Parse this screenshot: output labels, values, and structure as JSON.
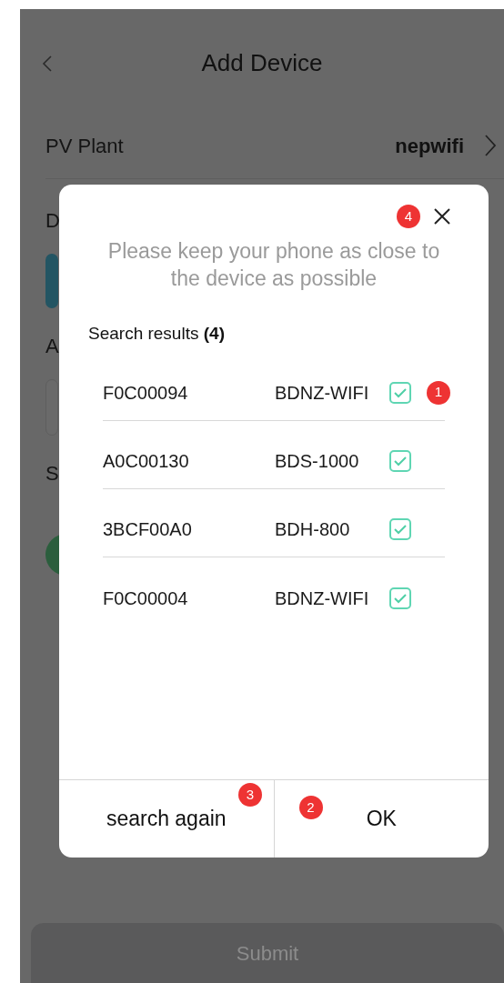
{
  "header": {
    "title": "Add Device"
  },
  "pv_plant": {
    "label": "PV Plant",
    "value": "nepwifi"
  },
  "partial_labels": [
    "D",
    "A",
    "S"
  ],
  "submit_button": {
    "label": "Submit",
    "disabled": true
  },
  "dialog": {
    "close_badge": "4",
    "message": "Please keep your phone as close to the device as possible",
    "results_label": "Search results **(4)**",
    "devices": [
      {
        "serial": "F0C00094",
        "model": "BDNZ-WIFI",
        "checked": true,
        "badge": "1"
      },
      {
        "serial": "A0C00130",
        "model": "BDS-1000",
        "checked": true
      },
      {
        "serial": "3BCF00A0",
        "model": "BDH-800",
        "checked": true
      },
      {
        "serial": "F0C00004",
        "model": "BDNZ-WIFI",
        "checked": true
      }
    ],
    "buttons": [
      {
        "label": "search again",
        "badge": "3"
      },
      {
        "label": "OK",
        "badge": "2"
      }
    ]
  }
}
